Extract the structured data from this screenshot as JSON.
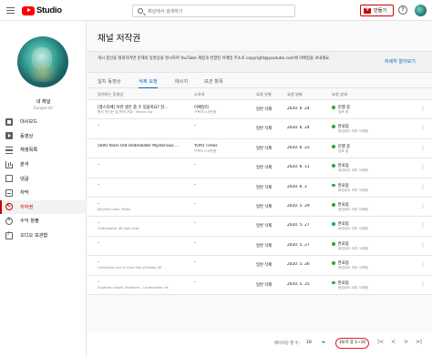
{
  "topbar": {
    "logo_text": "Studio",
    "search_placeholder": "채널에서 검색하기",
    "create_label": "만들기",
    "help_label": "?"
  },
  "sidebar": {
    "channel_name": "내 채널",
    "channel_sub": "Europe Uh",
    "items": [
      {
        "label": "대시보드",
        "icon": "dashboard-icon"
      },
      {
        "label": "동영상",
        "icon": "video-icon"
      },
      {
        "label": "재생목록",
        "icon": "playlist-icon"
      },
      {
        "label": "분석",
        "icon": "analytics-icon"
      },
      {
        "label": "댓글",
        "icon": "comment-icon"
      },
      {
        "label": "자막",
        "icon": "subtitles-icon"
      },
      {
        "label": "저작권",
        "icon": "copyright-icon",
        "active": true
      },
      {
        "label": "수익 창출",
        "icon": "monetization-icon"
      },
      {
        "label": "오디오 보관함",
        "icon": "audio-library-icon"
      }
    ]
  },
  "main": {
    "title": "채널 저작권",
    "banner_text": "게시 중인을 철회하려면 문제의 동영상을 명시하여 YouTube 계정과 연결된 이메일 주소로 copyright@youtube.com에 이메일을 보내세요.",
    "banner_link": "자세히 알아보기",
    "tabs": [
      "일치 동영상",
      "삭제 요청",
      "메시지",
      "보관 항목"
    ],
    "active_tab": 1,
    "columns": [
      "일치하는 동영상",
      "소유자",
      "요청 유형",
      "요청 날짜",
      "요청 상태"
    ],
    "rows": [
      {
        "title": "[맹스타체] 이번 생은 좀 수 있을까요? 현...",
        "sub": "원곡 댄서는 집 판매 가요 · Martis ray",
        "owner": "이예일리",
        "owner_sub": "구독자 0.0만명",
        "type": "일반 삭제",
        "date": "2020. 6. 24",
        "status": "진행 중",
        "status_sub": "검토 중"
      },
      {
        "title": "–",
        "sub": "",
        "owner": "–",
        "owner_sub": "",
        "type": "일반 삭제",
        "date": "2020. 6. 24",
        "status": "완료됨",
        "status_sub": "동영상이 이미 삭제됨"
      },
      {
        "title": "5000 Years Old Underwater Mysterious ...",
        "sub": "",
        "owner": "YOYO Times",
        "owner_sub": "구독자 0.0만명",
        "type": "일반 삭제",
        "date": "2020. 6. 23",
        "status": "진행 중",
        "status_sub": "검토 중"
      },
      {
        "title": "–",
        "sub": "",
        "owner": "–",
        "owner_sub": "",
        "type": "일반 삭제",
        "date": "2020. 6. 11",
        "status": "완료됨",
        "status_sub": "동영상이 이미 삭제됨"
      },
      {
        "title": "–",
        "sub": "",
        "owner": "–",
        "owner_sub": "",
        "type": "일반 삭제",
        "date": "2020. 6. 2",
        "status": "완료됨",
        "status_sub": "동영상이 이미 삭제됨"
      },
      {
        "title": "–",
        "sub": "Jellyfish Lake, Palau",
        "owner": "–",
        "owner_sub": "",
        "type": "일반 삭제",
        "date": "2020. 5. 29",
        "status": "완료됨",
        "status_sub": "동영상이 이미 삭제됨"
      },
      {
        "title": "–",
        "sub": "Underwater 4K look shot",
        "owner": "–",
        "owner_sub": "",
        "type": "일반 삭제",
        "date": "2020. 5. 27",
        "status": "완료됨",
        "status_sub": "동영상이 이미 삭제됨"
      },
      {
        "title": "–",
        "sub": "",
        "owner": "–",
        "owner_sub": "",
        "type": "일반 삭제",
        "date": "2020. 5. 27",
        "status": "완료됨",
        "status_sub": "동영상이 이미 삭제됨"
      },
      {
        "title": "–",
        "sub": "Christmas eve in East Sea of Korea 4K",
        "owner": "–",
        "owner_sub": "",
        "type": "일반 삭제",
        "date": "2020. 5. 26",
        "status": "완료됨",
        "status_sub": "동영상이 이미 삭제됨"
      },
      {
        "title": "–",
        "sub": "Southern Atolls, Maldives - Underwater 4K",
        "owner": "–",
        "owner_sub": "",
        "type": "일반 삭제",
        "date": "2020. 5. 25",
        "status": "완료됨",
        "status_sub": "동영상이 이미 삭제됨"
      }
    ]
  },
  "footer": {
    "rows_label": "페이지당 행 수:",
    "rows_value": "10",
    "range": "10/가 중 1~10",
    "first": "|<",
    "prev": "<",
    "next": ">",
    "last": ">|"
  },
  "colors": {
    "brand": "#ff0000",
    "accent_blue": "#065fd4",
    "status_green": "#2ba640",
    "active_red": "#cc0000"
  }
}
